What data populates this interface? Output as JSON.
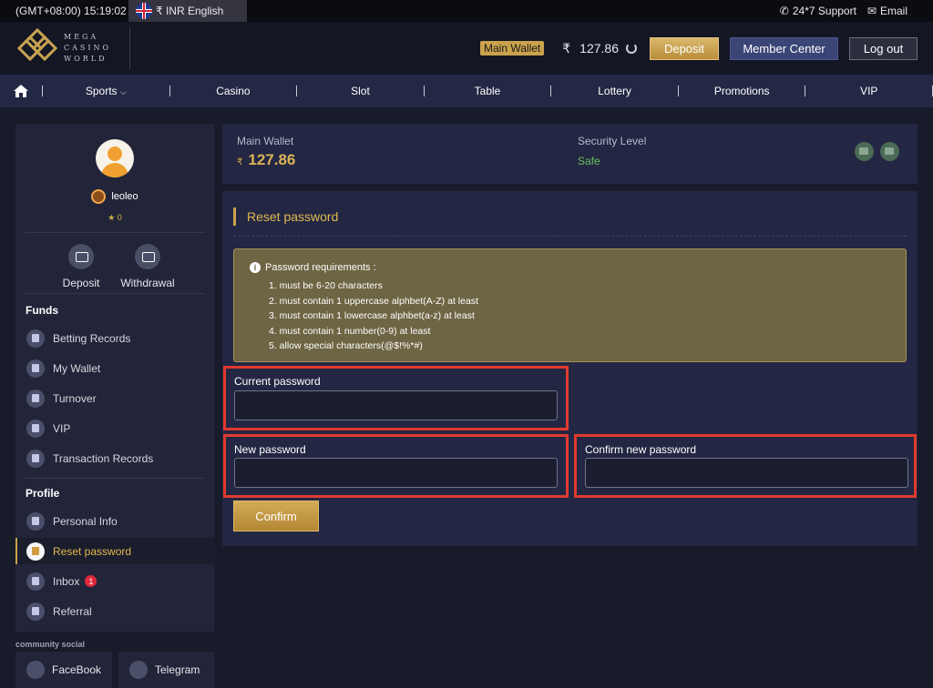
{
  "topbar": {
    "time": "(GMT+08:00) 15:19:02",
    "currency_lang": "₹ INR English",
    "support": "24*7 Support",
    "email": "Email"
  },
  "header": {
    "logo_line1": "MEGA",
    "logo_line2": "CASINO",
    "logo_line3": "WORLD",
    "wallet_tag": "Main Wallet",
    "currency_symbol": "₹",
    "balance": "127.86",
    "deposit": "Deposit",
    "member_center": "Member Center",
    "logout": "Log out"
  },
  "nav": {
    "items": [
      "Sports",
      "Casino",
      "Slot",
      "Table",
      "Lottery",
      "Promotions",
      "VIP"
    ]
  },
  "sidebar": {
    "username": "leoleo",
    "stars": "★ 0",
    "quick_actions": [
      "Deposit",
      "Withdrawal"
    ],
    "funds_title": "Funds",
    "funds_items": [
      "Betting Records",
      "My Wallet",
      "Turnover",
      "VIP",
      "Transaction Records"
    ],
    "profile_title": "Profile",
    "profile_items": [
      "Personal Info",
      "Reset password",
      "Inbox",
      "Referral"
    ],
    "inbox_badge": "1",
    "community_title": "community social",
    "social": [
      "FaceBook",
      "Telegram"
    ]
  },
  "wallet_panel": {
    "main_wallet_label": "Main Wallet",
    "currency": "₹",
    "amount": "127.86",
    "security_label": "Security Level",
    "security_value": "Safe"
  },
  "form": {
    "title": "Reset password",
    "req_title": "Password requirements :",
    "requirements": [
      "1. must be 6-20 characters",
      "2. must contain 1 uppercase alphbet(A-Z) at least",
      "3. must contain 1 lowercase alphbet(a-z) at least",
      "4. must contain 1 number(0-9) at least",
      "5. allow special characters(@$!%*#)"
    ],
    "current_label": "Current password",
    "new_label": "New password",
    "confirm_label": "Confirm new password",
    "current_value": "",
    "new_value": "",
    "confirm_value": "",
    "confirm_button": "Confirm"
  }
}
